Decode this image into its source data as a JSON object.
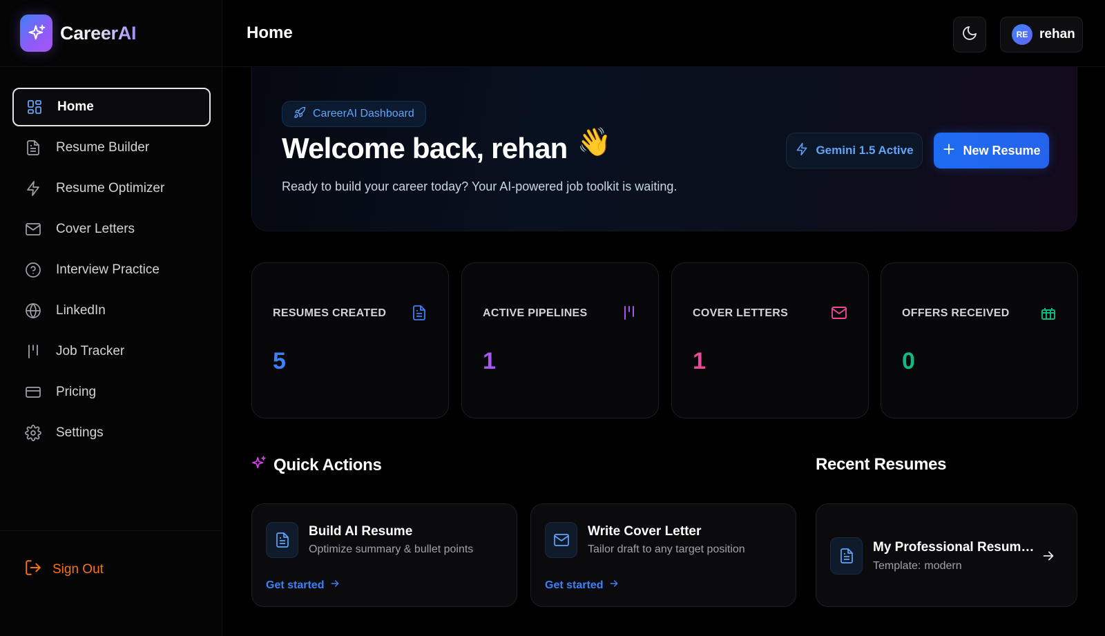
{
  "app": {
    "name": "CareerAI"
  },
  "header": {
    "title": "Home",
    "user_initials": "RE",
    "user_name": "rehan"
  },
  "sidebar": {
    "items": [
      {
        "label": "Home",
        "icon": "grid-icon",
        "active": true
      },
      {
        "label": "Resume Builder",
        "icon": "file-text-icon"
      },
      {
        "label": "Resume Optimizer",
        "icon": "lightning-icon"
      },
      {
        "label": "Cover Letters",
        "icon": "mail-icon"
      },
      {
        "label": "Interview Practice",
        "icon": "help-circle-icon"
      },
      {
        "label": "LinkedIn",
        "icon": "globe-icon"
      },
      {
        "label": "Job Tracker",
        "icon": "kanban-icon"
      },
      {
        "label": "Pricing",
        "icon": "credit-card-icon"
      },
      {
        "label": "Settings",
        "icon": "gear-icon"
      }
    ],
    "sign_out": "Sign Out"
  },
  "hero": {
    "badge": "CareerAI Dashboard",
    "title": "Welcome back, rehan",
    "wave_emoji": "👋",
    "subtitle": "Ready to build your career today? Your AI-powered job toolkit is waiting.",
    "gemini_label": "Gemini 1.5 Active",
    "new_resume_label": "New Resume"
  },
  "stats": [
    {
      "label": "RESUMES CREATED",
      "value": "5",
      "color": "#3b82f6",
      "icon": "file-text-icon"
    },
    {
      "label": "ACTIVE PIPELINES",
      "value": "1",
      "color": "#a855f7",
      "icon": "kanban-icon"
    },
    {
      "label": "COVER LETTERS",
      "value": "1",
      "color": "#ec4899",
      "icon": "mail-icon"
    },
    {
      "label": "OFFERS RECEIVED",
      "value": "0",
      "color": "#10b981",
      "icon": "gift-icon"
    }
  ],
  "quick_actions": {
    "title": "Quick Actions",
    "items": [
      {
        "title": "Build AI Resume",
        "desc": "Optimize summary & bullet points",
        "link": "Get started"
      },
      {
        "title": "Write Cover Letter",
        "desc": "Tailor draft to any target position",
        "link": "Get started"
      }
    ]
  },
  "recent_resumes": {
    "title": "Recent Resumes",
    "items": [
      {
        "name": "My Professional Resume (...",
        "template_label": "Template:",
        "template": "modern"
      }
    ]
  },
  "colors": {
    "accent": "#2563eb",
    "signout": "#f97316"
  }
}
